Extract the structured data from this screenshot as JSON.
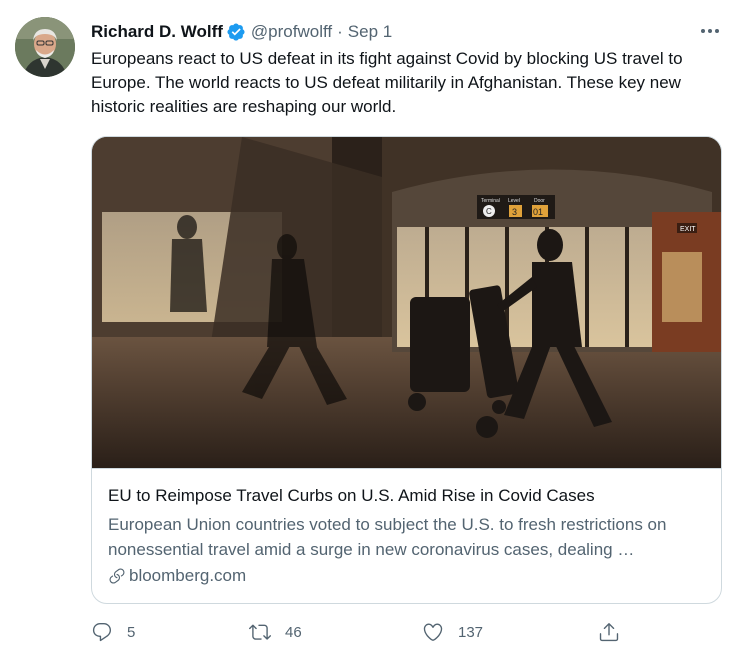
{
  "author": {
    "name": "Richard D. Wolff",
    "handle": "@profwolff",
    "separator": "·",
    "date": "Sep 1",
    "verified_icon": "verified-badge-icon",
    "avatar_icon": "avatar"
  },
  "tweet": {
    "text": "Europeans react to US defeat in its fight against Covid by blocking US travel to Europe. The world reacts to US defeat militarily in Afghanistan. These key new historic realities are reshaping our world."
  },
  "card": {
    "title": "EU to Reimpose Travel Curbs on U.S. Amid Rise in Covid Cases",
    "description": "European Union countries voted to subject the U.S. to fresh restrictions on nonessential travel amid a surge in new coronavirus cases, dealing …",
    "domain": "bloomberg.com",
    "image_signs": {
      "terminal": "C",
      "level": "3",
      "door": "01",
      "terminal_label": "Terminal",
      "level_label": "Level",
      "door_label": "Door",
      "exit": "EXIT"
    }
  },
  "actions": {
    "reply_count": "5",
    "retweet_count": "46",
    "like_count": "137"
  },
  "colors": {
    "text": "#0f1419",
    "secondary": "#536471",
    "verified": "#1d9bf0",
    "border": "#cfd9de"
  }
}
